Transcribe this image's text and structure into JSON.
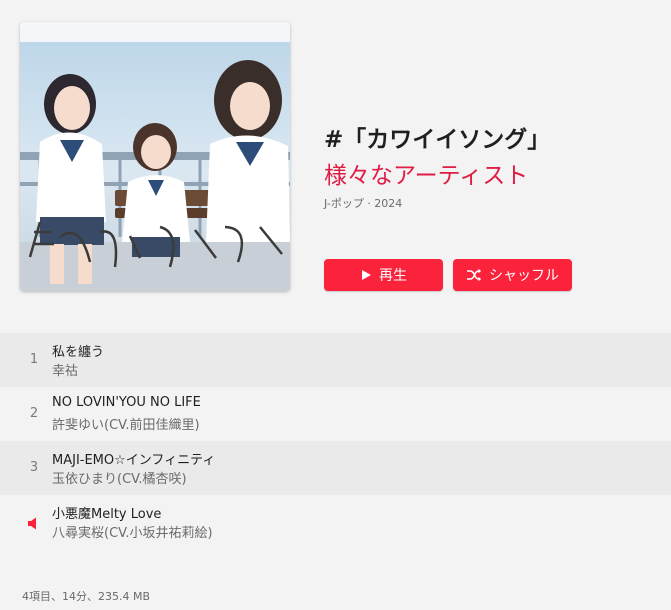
{
  "album": {
    "cover_icon": "album-artwork",
    "title": "#「カワイイソング」",
    "artist": "様々なアーティスト",
    "meta": "J-ポップ · 2024"
  },
  "actions": {
    "play_label": "再生",
    "shuffle_label": "シャッフル"
  },
  "tracks": [
    {
      "number": "1",
      "title": "私を纏う",
      "artist": "幸祜",
      "playing": false
    },
    {
      "number": "2",
      "title": "NO LOVIN'YOU NO LIFE",
      "artist": "許斐ゆい(CV.前田佳織里)",
      "playing": false
    },
    {
      "number": "3",
      "title": "MAJI-EMO☆インフィニティ",
      "artist": "玉依ひまり(CV.橘杏咲)",
      "playing": false
    },
    {
      "number": "",
      "title": "小悪魔Melty Love",
      "artist": "八尋実桜(CV.小坂井祐莉絵)",
      "playing": true,
      "indicator_icon": "speaker-icon"
    }
  ],
  "footer": "4項目、14分、235.4 MB",
  "colors": {
    "accent": "#fa233b",
    "artist_text": "#e01e45",
    "background": "#f3f3f3"
  }
}
